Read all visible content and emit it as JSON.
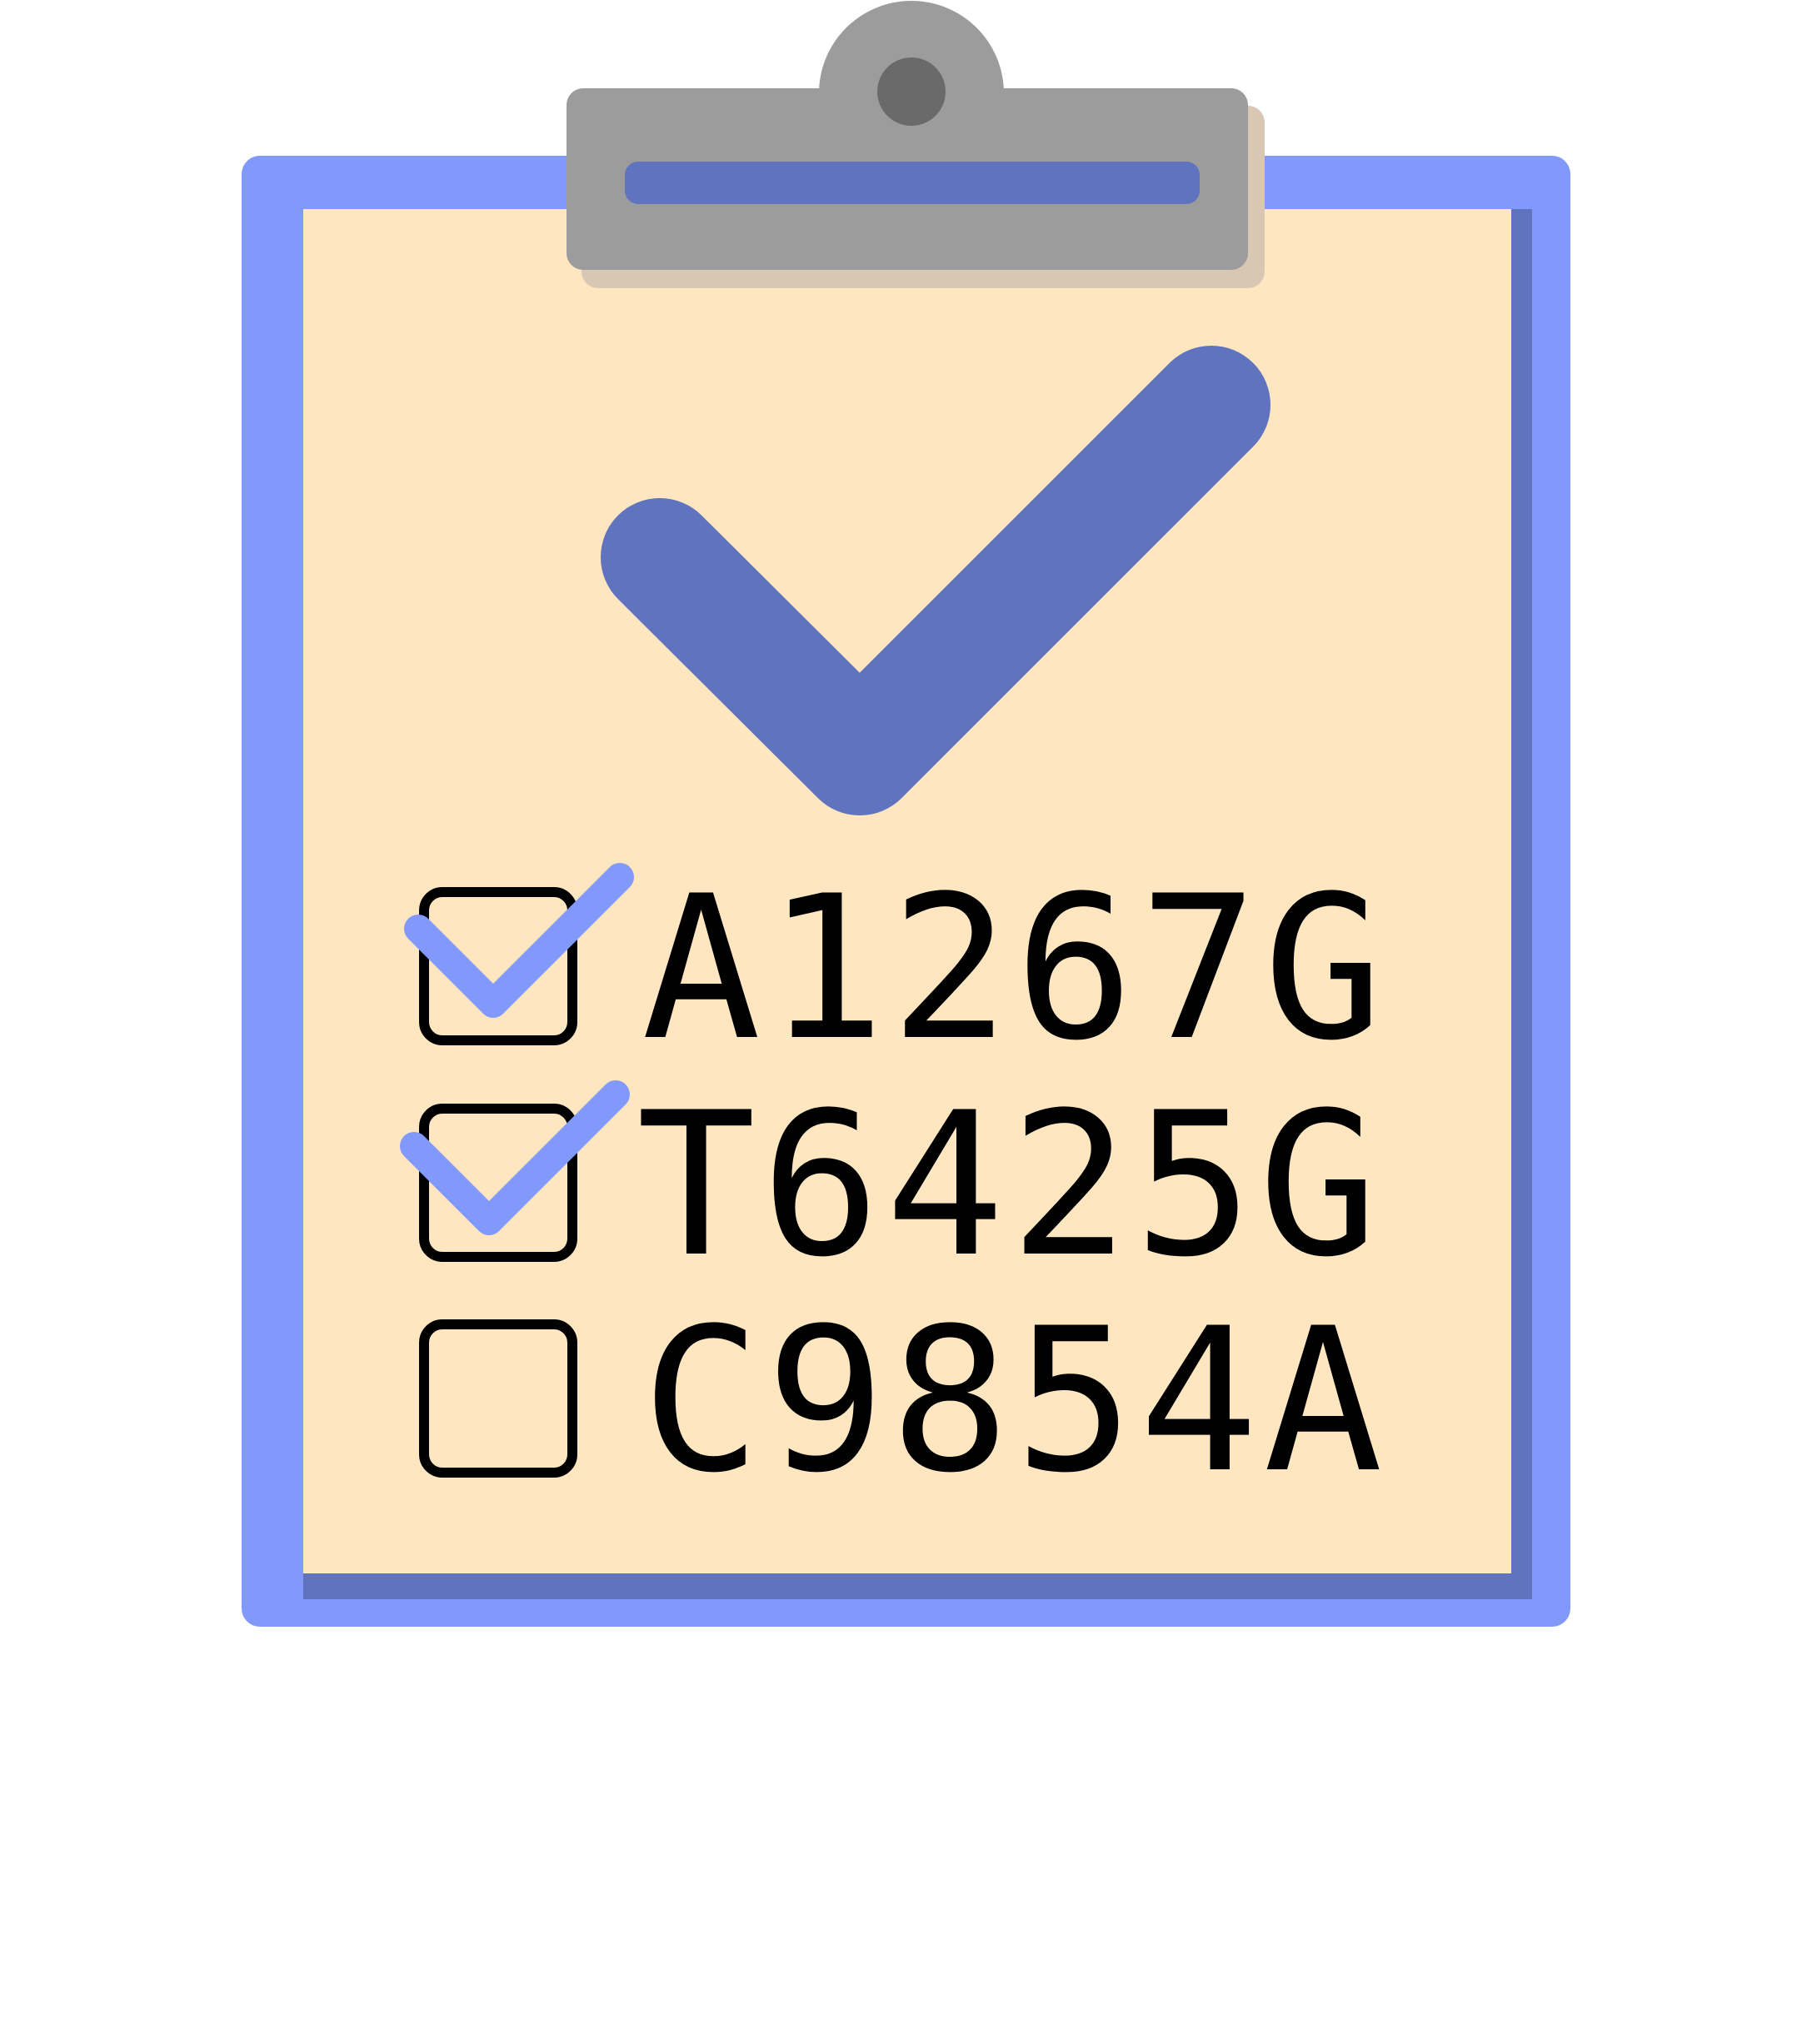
{
  "colors": {
    "board": "#8299fc",
    "board_shadow": "#5f73bf",
    "paper": "#fee6c1",
    "clip": "#9c9c9c",
    "clip_hole": "#6a6a6a",
    "clip_shadow": "#d8c8b3",
    "check_big": "#5f73bf",
    "check_small": "#8299fc",
    "text": "#000000"
  },
  "icons": {
    "header": "big-checkmark-icon",
    "checked": "checkbox-checked-icon",
    "unchecked": "checkbox-empty-icon"
  },
  "checklist": {
    "items": [
      {
        "label": "A1267G",
        "checked": true
      },
      {
        "label": "T6425G",
        "checked": true
      },
      {
        "label": "C9854A",
        "checked": false
      }
    ]
  }
}
